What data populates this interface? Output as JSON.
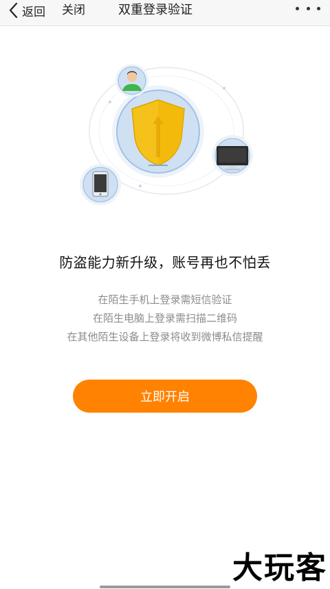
{
  "navbar": {
    "back_label": "返回",
    "close_label": "关闭",
    "title": "双重登录验证",
    "more_icon": "more-dots-icon"
  },
  "illustration": {
    "icons": [
      "user-avatar-icon",
      "shield-icon",
      "monitor-icon",
      "phone-icon"
    ]
  },
  "content": {
    "headline": "防盗能力新升级，账号再也不怕丢",
    "descriptions": [
      "在陌生手机上登录需短信验证",
      "在陌生电脑上登录需扫描二维码",
      "在其他陌生设备上登录将收到微博私信提醒"
    ]
  },
  "action": {
    "enable_label": "立即开启",
    "color": "#ff8200"
  },
  "watermark": "大玩客",
  "colors": {
    "accent": "#ff8200",
    "navbar_bg": "#f7f7f7",
    "description_text": "#8c8c8c"
  }
}
